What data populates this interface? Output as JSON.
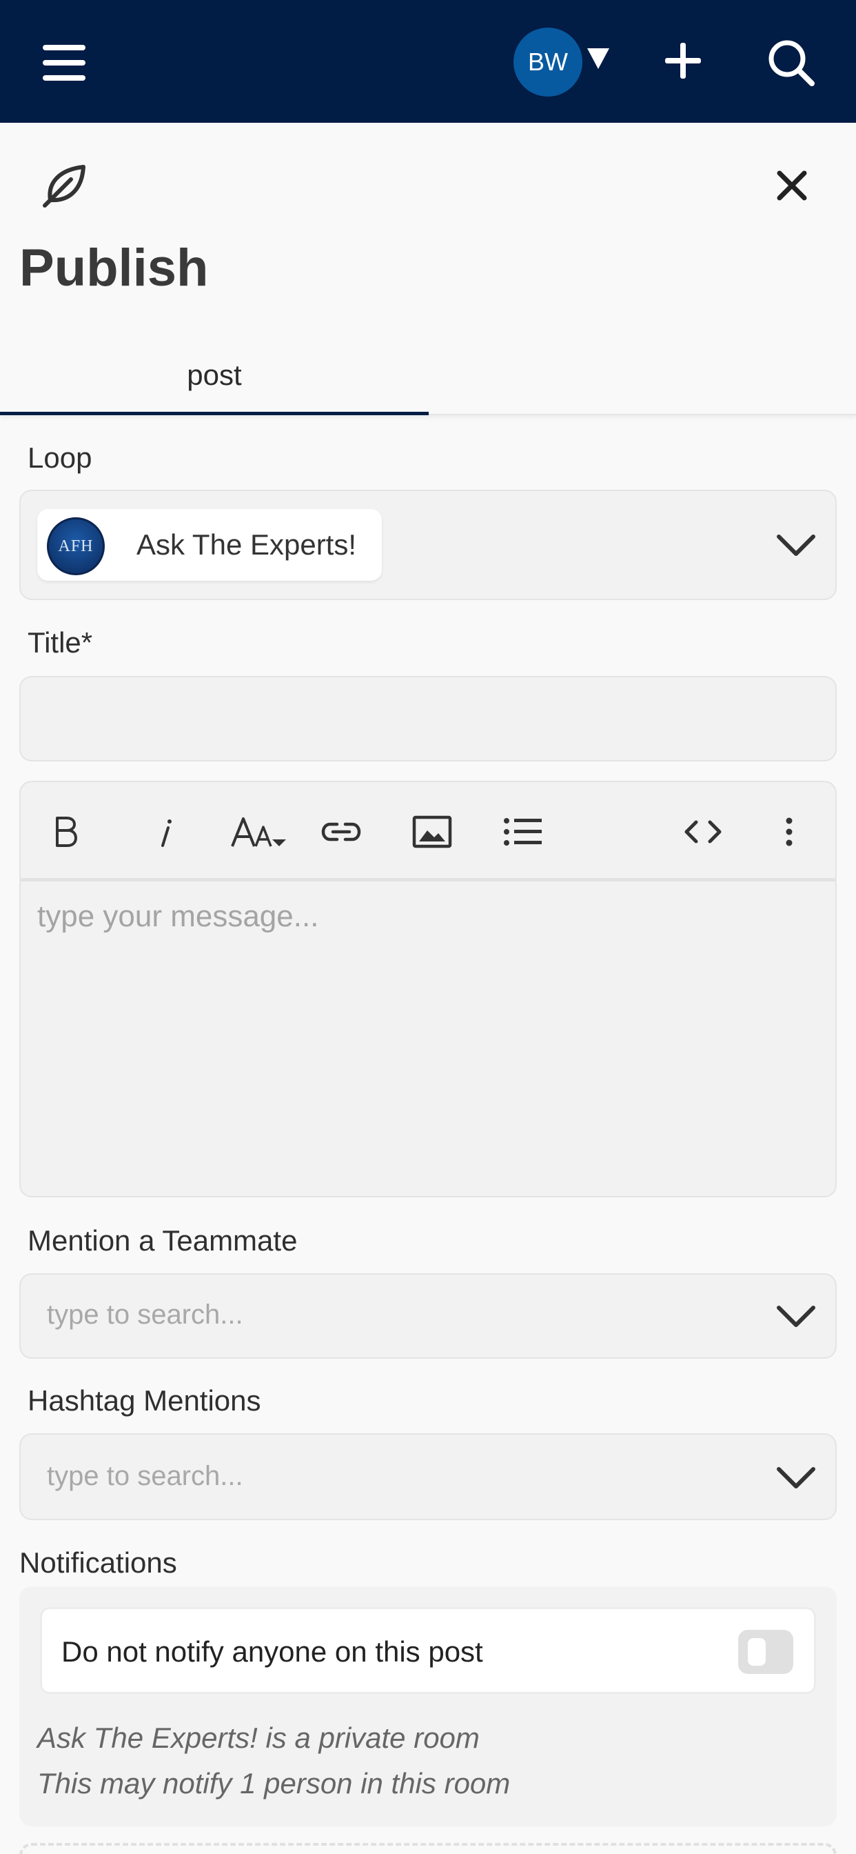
{
  "header": {
    "avatar_initials": "BW",
    "icons": [
      "hamburger-menu-icon",
      "caret-down-icon",
      "plus-icon",
      "search-icon"
    ],
    "bg_color": "#011c45",
    "avatar_color": "#075aa0"
  },
  "page": {
    "title": "Publish",
    "icons": [
      "leaf-icon",
      "close-icon"
    ]
  },
  "tabs": [
    {
      "label": "post",
      "active": true
    }
  ],
  "loop": {
    "label": "Loop",
    "selected_name": "Ask The Experts!",
    "logo_text": "AFH"
  },
  "title_field": {
    "label": "Title*",
    "value": ""
  },
  "editor": {
    "toolbar": [
      "bold-icon",
      "italic-icon",
      "font-size-icon",
      "link-icon",
      "image-icon",
      "bullet-list-icon",
      "code-icon",
      "more-icon"
    ],
    "placeholder": "type your message..."
  },
  "mention": {
    "label": "Mention a Teammate",
    "placeholder": "type to search..."
  },
  "hashtags": {
    "label": "Hashtag Mentions",
    "placeholder": "type to search..."
  },
  "notifications": {
    "label": "Notifications",
    "toggle_label": "Do not notify anyone on this post",
    "toggle_on": false,
    "note_line1": "Ask The Experts! is a private room",
    "note_line2": "This may notify 1 person in this room"
  }
}
